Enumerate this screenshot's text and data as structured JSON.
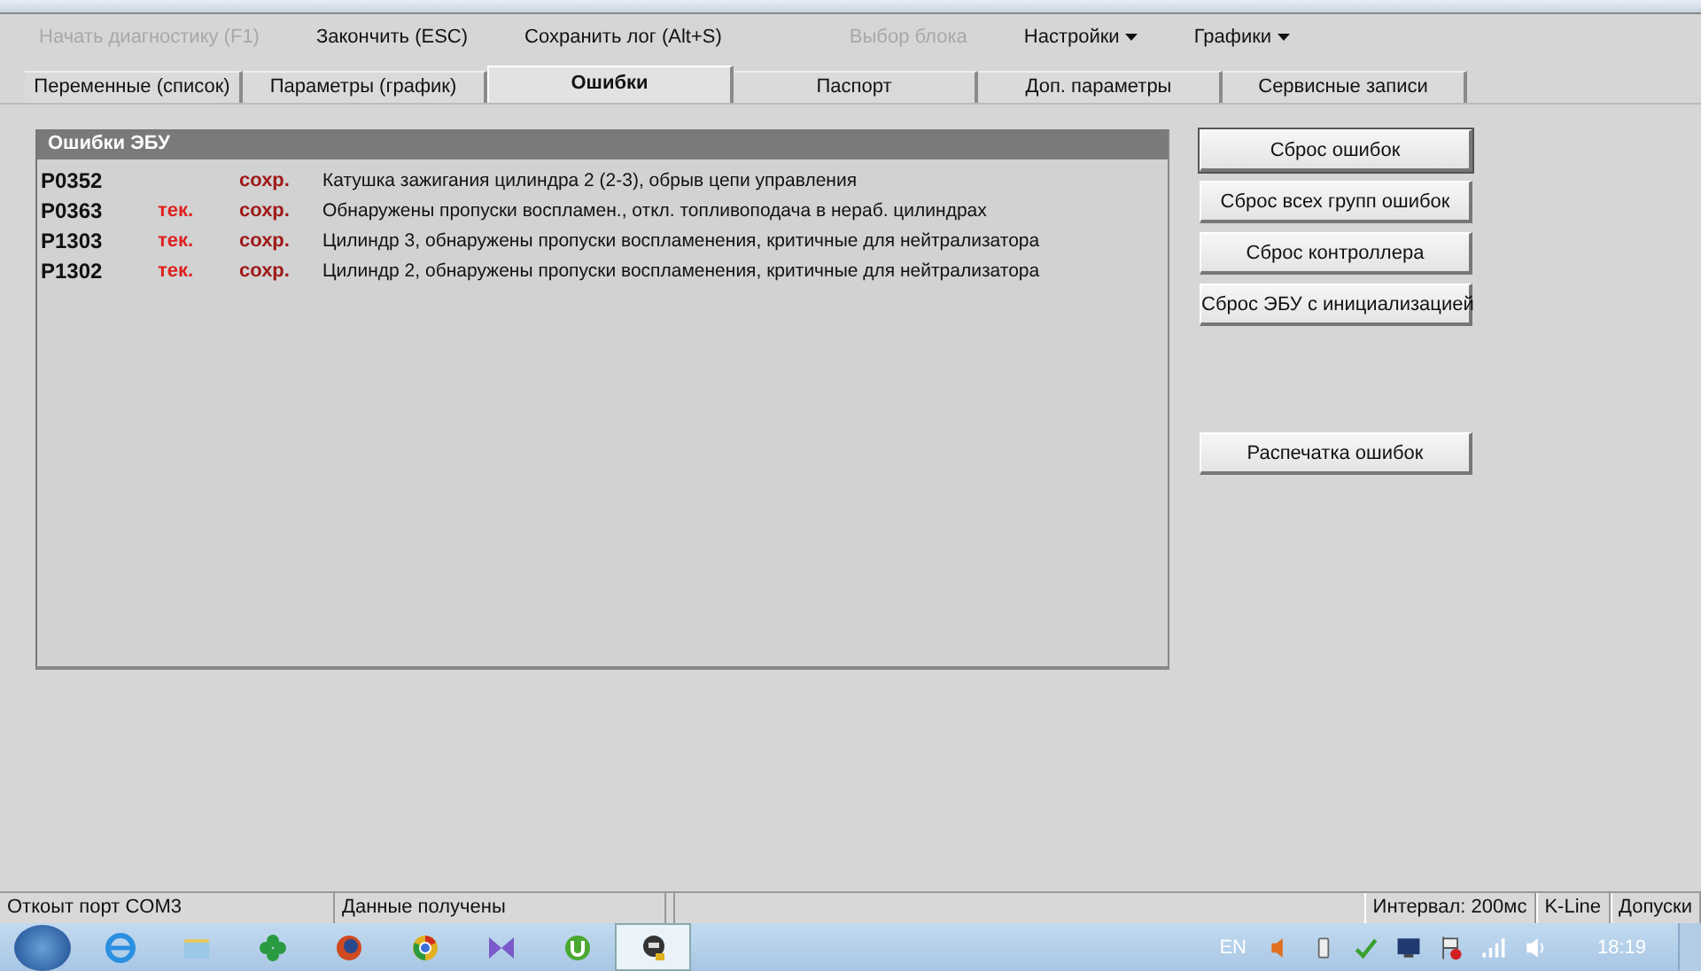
{
  "menu": [
    {
      "label": "Начать диагностику (F1)",
      "disabled": true,
      "dropdown": false
    },
    {
      "label": "Закончить (ESC)",
      "disabled": false,
      "dropdown": false
    },
    {
      "label": "Сохранить лог (Alt+S)",
      "disabled": false,
      "dropdown": false
    },
    {
      "label": "Выбор блока",
      "disabled": true,
      "dropdown": false
    },
    {
      "label": "Настройки",
      "disabled": false,
      "dropdown": true
    },
    {
      "label": "Графики",
      "disabled": false,
      "dropdown": true
    }
  ],
  "tabs": [
    {
      "label": "Переменные (список)",
      "selected": false
    },
    {
      "label": "Параметры (график)",
      "selected": false
    },
    {
      "label": "Ошибки",
      "selected": true
    },
    {
      "label": "Паспорт",
      "selected": false
    },
    {
      "label": "Доп. параметры",
      "selected": false
    },
    {
      "label": "Сервисные записи",
      "selected": false
    }
  ],
  "errors_panel": {
    "title": "Ошибки ЭБУ",
    "rows": [
      {
        "code": "P0352",
        "stored": "сохр.",
        "description": "Катушка зажигания цилиндра 2 (2-3), обрыв цепи управления"
      },
      {
        "code": "P0363",
        "current": "тек.",
        "stored": "сохр.",
        "description": "Обнаружены пропуски воспламен., откл. топливоподача в нераб. цилиндрах"
      },
      {
        "code": "P1303",
        "current": "тек.",
        "stored": "сохр.",
        "description": "Цилиндр 3, обнаружены пропуски воспламенения, критичные для нейтрализатора"
      },
      {
        "code": "P1302",
        "current": "тек.",
        "stored": "сохр.",
        "description": "Цилиндр 2, обнаружены пропуски воспламенения, критичные для нейтрализатора"
      }
    ]
  },
  "buttons": [
    {
      "label": "Сброс ошибок",
      "kind": "default"
    },
    {
      "label": "Сброс всех групп ошибок",
      "kind": "normal"
    },
    {
      "label": "Сброс контроллера",
      "kind": "normal"
    },
    {
      "label": "Сброс ЭБУ с инициализацией",
      "kind": "normal"
    },
    {
      "label": "Распечатка ошибок",
      "kind": "spaced"
    }
  ],
  "status_bar": {
    "left": [
      "Откоыт порт COM3",
      "Данные получены"
    ],
    "right": [
      "Интервал: 200мс",
      "K-Line",
      "Допуски"
    ]
  },
  "taskbar": {
    "apps": [
      {
        "kind": "ie",
        "selected": false
      },
      {
        "kind": "folder",
        "selected": false
      },
      {
        "kind": "clover",
        "selected": false
      },
      {
        "kind": "firefox",
        "selected": false
      },
      {
        "kind": "chrome",
        "selected": false
      },
      {
        "kind": "vs",
        "selected": false
      },
      {
        "kind": "torrent",
        "selected": false
      },
      {
        "kind": "app",
        "selected": true
      }
    ],
    "language": "EN",
    "clock": "18:19"
  }
}
